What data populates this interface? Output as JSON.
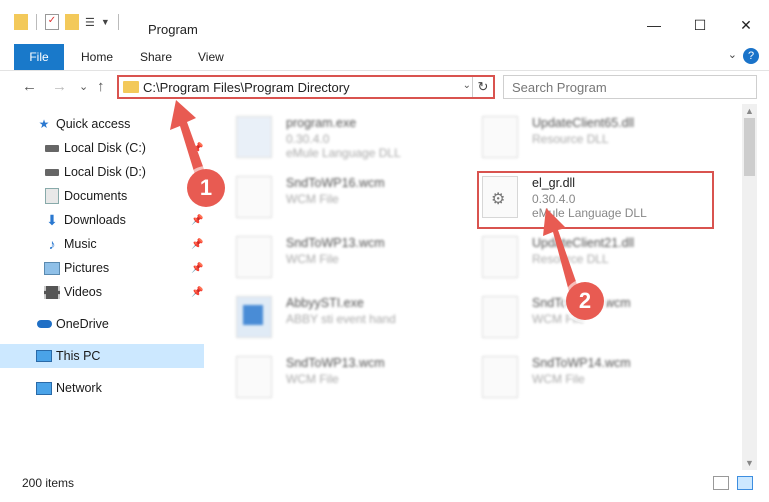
{
  "window": {
    "title": "Program",
    "minimize": "—",
    "maximize": "☐",
    "close": "✕"
  },
  "ribbon": {
    "tabs": [
      "File",
      "Home",
      "Share",
      "View"
    ],
    "help": "?",
    "expand": "⌄"
  },
  "nav": {
    "back": "←",
    "forward": "→",
    "recent": "⌄",
    "up": "↑"
  },
  "address": {
    "path": "C:\\Program Files\\Program Directory",
    "dropdown": "⌄",
    "refresh": "↻"
  },
  "search": {
    "placeholder": "Search Program"
  },
  "sidebar": {
    "items": [
      {
        "label": "Quick access",
        "icon": "star-icon",
        "pinned": false
      },
      {
        "label": "Local Disk (C:)",
        "icon": "drive-icon",
        "pinned": true
      },
      {
        "label": "Local Disk (D:)",
        "icon": "drive-icon",
        "pinned": false
      },
      {
        "label": "Documents",
        "icon": "documents-icon",
        "pinned": true
      },
      {
        "label": "Downloads",
        "icon": "download-icon",
        "pinned": true
      },
      {
        "label": "Music",
        "icon": "music-icon",
        "pinned": true
      },
      {
        "label": "Pictures",
        "icon": "pictures-icon",
        "pinned": true
      },
      {
        "label": "Videos",
        "icon": "videos-icon",
        "pinned": true
      },
      {
        "label": "OneDrive",
        "icon": "cloud-icon",
        "pinned": false
      },
      {
        "label": "This PC",
        "icon": "computer-icon",
        "pinned": false
      },
      {
        "label": "Network",
        "icon": "network-icon",
        "pinned": false
      }
    ]
  },
  "files": [
    {
      "name": "program.exe",
      "line2": "0.30.4.0",
      "line3": "eMule Language DLL"
    },
    {
      "name": "UpdateClient65.dll",
      "line2": "Resource DLL",
      "line3": ""
    },
    {
      "name": "SndToWP16.wcm",
      "line2": "WCM File",
      "line3": ""
    },
    {
      "name": "el_gr.dll",
      "line2": "0.30.4.0",
      "line3": "eMule Language DLL"
    },
    {
      "name": "SndToWP13.wcm",
      "line2": "WCM File",
      "line3": ""
    },
    {
      "name": "UpdateClient21.dll",
      "line2": "Resource DLL",
      "line3": ""
    },
    {
      "name": "AbbyySTI.exe",
      "line2": "ABBY sti event hand",
      "line3": ""
    },
    {
      "name": "SndToWP10.wcm",
      "line2": "WCM File",
      "line3": ""
    },
    {
      "name": "SndToWP13.wcm",
      "line2": "WCM File",
      "line3": ""
    },
    {
      "name": "SndToWP14.wcm",
      "line2": "WCM File",
      "line3": ""
    }
  ],
  "status": {
    "item_count": "200 items"
  },
  "callouts": {
    "one": "1",
    "two": "2"
  },
  "colors": {
    "accent": "#1979ca",
    "highlight": "#d9534f",
    "badge": "#e85b52",
    "selection": "#cce8ff"
  }
}
